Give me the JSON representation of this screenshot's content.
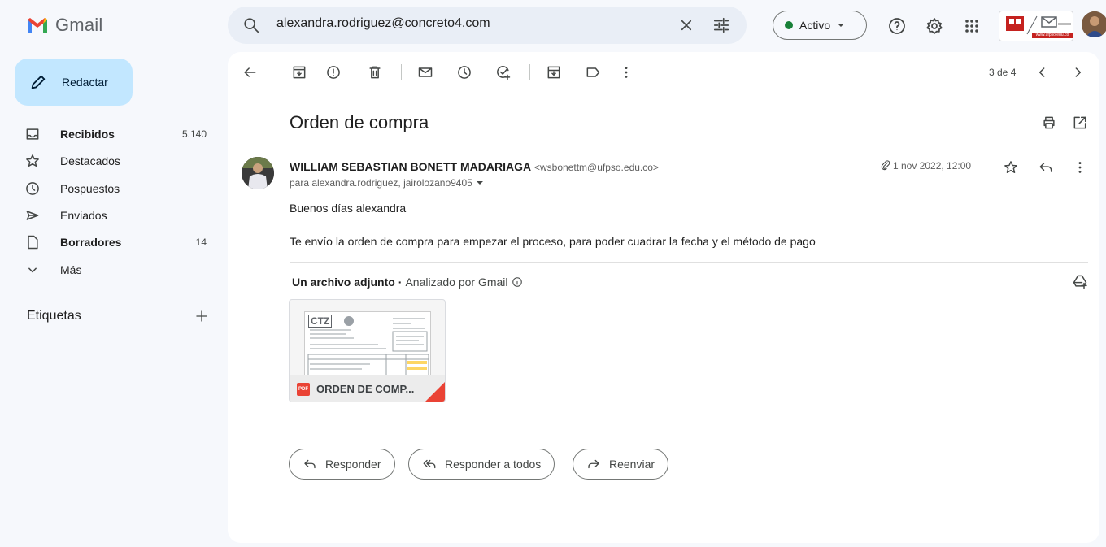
{
  "app": {
    "name": "Gmail"
  },
  "search": {
    "query": "alexandra.rodriguez@concreto4.com"
  },
  "status": {
    "label": "Activo",
    "color": "#188038"
  },
  "compose": {
    "label": "Redactar"
  },
  "nav": {
    "items": [
      {
        "label": "Recibidos",
        "count": "5.140",
        "icon": "inbox-icon",
        "bold": true
      },
      {
        "label": "Destacados",
        "count": "",
        "icon": "star-icon",
        "bold": false
      },
      {
        "label": "Pospuestos",
        "count": "",
        "icon": "clock-icon",
        "bold": false
      },
      {
        "label": "Enviados",
        "count": "",
        "icon": "send-icon",
        "bold": false
      },
      {
        "label": "Borradores",
        "count": "14",
        "icon": "draft-icon",
        "bold": true
      },
      {
        "label": "Más",
        "count": "",
        "icon": "chevron-down-icon",
        "bold": false
      }
    ],
    "labels_heading": "Etiquetas"
  },
  "toolbar": {
    "pager": "3 de 4"
  },
  "email": {
    "subject": "Orden de compra",
    "sender_name": "WILLIAM SEBASTIAN BONETT MADARIAGA",
    "sender_email": "<wsbonettm@ufpso.edu.co>",
    "recipients": "para alexandra.rodriguez, jairolozano9405",
    "date": "1 nov 2022, 12:00",
    "body": [
      "Buenos días alexandra",
      "Te envío la orden de compra para empezar el proceso, para poder cuadrar la fecha y el método de pago"
    ]
  },
  "attachments": {
    "heading": "Un archivo adjunto",
    "scanned": "Analizado por Gmail",
    "file": {
      "name": "ORDEN DE COMP...",
      "type_badge": "PDF",
      "preview_logo": "CTZ"
    }
  },
  "brand": {
    "url": "www.ufpso.edu.co"
  },
  "actions": {
    "reply": "Responder",
    "reply_all": "Responder a todos",
    "forward": "Reenviar"
  }
}
